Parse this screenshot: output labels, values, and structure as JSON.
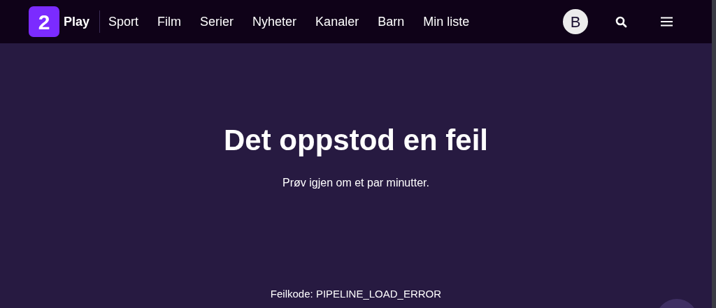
{
  "header": {
    "logo_mark": "2",
    "logo_text": "Play",
    "nav": [
      {
        "label": "Sport"
      },
      {
        "label": "Film"
      },
      {
        "label": "Serier"
      },
      {
        "label": "Nyheter"
      },
      {
        "label": "Kanaler"
      },
      {
        "label": "Barn"
      },
      {
        "label": "Min liste"
      }
    ],
    "avatar": "B"
  },
  "error": {
    "title": "Det oppstod en feil",
    "message": "Prøv igjen om et par minutter.",
    "code": "Feilkode: PIPELINE_LOAD_ERROR"
  }
}
